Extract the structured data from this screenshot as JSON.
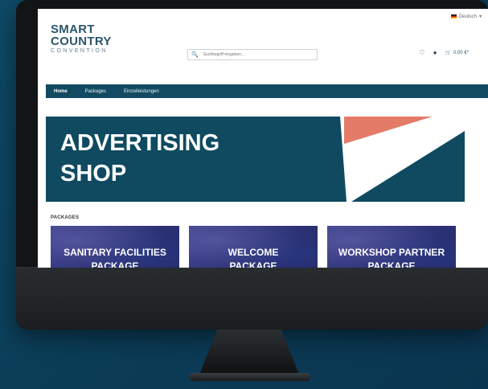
{
  "language": {
    "label": "Deutsch",
    "caret": "▾"
  },
  "logo": {
    "line1": "SMART",
    "line2": "COUNTRY",
    "line3": "CONVENTION"
  },
  "search": {
    "placeholder": "Suchbegriff eingeben..."
  },
  "header": {
    "cart_total": "0,00 €*"
  },
  "nav": {
    "items": [
      "Home",
      "Packages",
      "Einzelleistungen"
    ]
  },
  "banner": {
    "title_line1": "ADVERTISING",
    "title_line2": "SHOP"
  },
  "packages": {
    "heading": "PACKAGES",
    "cards": [
      {
        "line1": "SANITARY FACILITIES",
        "line2": "PACKAGE"
      },
      {
        "line1": "WELCOME",
        "line2": "PACKAGE"
      },
      {
        "line1": "WORKSHOP PARTNER",
        "line2": "PACKAGE"
      }
    ]
  },
  "colors": {
    "brand": "#124a61",
    "accent": "#e47b68",
    "card": "#2f347a"
  }
}
